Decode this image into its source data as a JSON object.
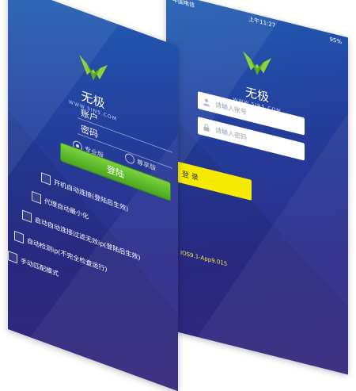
{
  "back_phone": {
    "status": {
      "carrier": "中国电信",
      "time": "上午11:27",
      "battery": "95%"
    },
    "brand": "无极",
    "url": "WWW.5IN5.COM",
    "account_placeholder": "请输入账号",
    "password_placeholder": "请输入密码",
    "login_label": "登 录",
    "version": "IOS9.1-App9.015"
  },
  "front_phone": {
    "brand": "无极",
    "url": "WWW.5IN5.COM",
    "account_label": "账户",
    "password_label": "密码",
    "radio_options": [
      "专业版",
      "尊享版"
    ],
    "login_label": "登陆",
    "checkboxes": [
      "开机自动连接(登陆后生效)",
      "代理自动最小化",
      "启动自动连接过滤无效ip(登陆后生效)",
      "自动检测ip(不完全检查运行)",
      "手动匹配模式"
    ]
  },
  "colors": {
    "accent_green": "#6cc531",
    "accent_yellow": "#f5ea00",
    "bg_blue": "#243f9c"
  }
}
